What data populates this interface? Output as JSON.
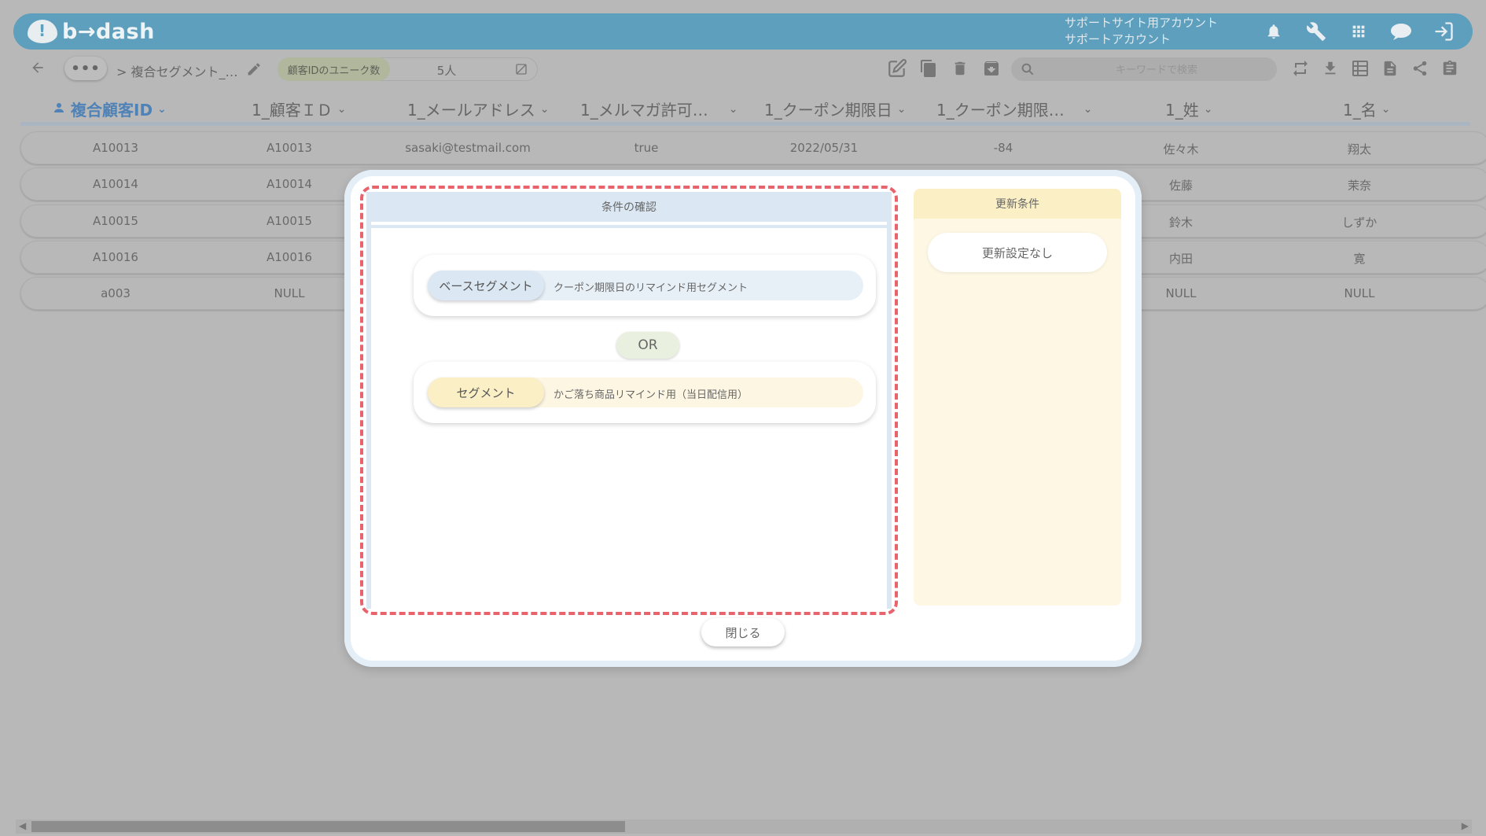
{
  "header": {
    "brand": "b→dash",
    "account_line1": "サポートサイト用アカウント",
    "account_line2": "サポートアカウント"
  },
  "toolbar": {
    "more_label": "•••",
    "breadcrumb": "> 複合セグメント_…",
    "unique_label": "顧客IDのユニーク数",
    "unique_value": "5人",
    "search_placeholder": "キーワードで検索"
  },
  "table": {
    "columns": [
      "複合顧客ID",
      "1_顧客ＩＤ",
      "1_メールアドレス",
      "1_メルマガ許可…",
      "1_クーポン期限日",
      "1_クーポン期限…",
      "1_姓",
      "1_名"
    ],
    "rows": [
      [
        "A10013",
        "A10013",
        "sasaki@testmail.com",
        "true",
        "2022/05/31",
        "-84",
        "佐々木",
        "翔太"
      ],
      [
        "A10014",
        "A10014",
        "",
        "",
        "",
        "",
        "佐藤",
        "茉奈"
      ],
      [
        "A10015",
        "A10015",
        "",
        "",
        "",
        "",
        "鈴木",
        "しずか"
      ],
      [
        "A10016",
        "A10016",
        "",
        "",
        "",
        "",
        "内田",
        "寛"
      ],
      [
        "a003",
        "NULL",
        "",
        "",
        "",
        "",
        "NULL",
        "NULL"
      ]
    ]
  },
  "modal": {
    "conditions_title": "条件の確認",
    "base_segment_label": "ベースセグメント",
    "base_segment_name": "クーポン期限日のリマインド用セグメント",
    "operator": "OR",
    "segment_label": "セグメント",
    "segment_name": "かご落ち商品リマインド用（当日配信用）",
    "update_title": "更新条件",
    "update_none": "更新設定なし",
    "close_label": "閉じる"
  },
  "colors": {
    "appbar": "#5d9fbd",
    "dashed_highlight": "#e8636c",
    "conditions_header": "#dbe8f3",
    "base_segment_pill": "#dbe8f3",
    "segment_pill": "#fbefc6",
    "update_panel": "#fdf7e4"
  },
  "icons": [
    "bell-icon",
    "wrench-icon",
    "apps-grid-icon",
    "chat-bubble-icon",
    "logout-icon",
    "back-arrow-icon",
    "pencil-icon",
    "visibility-off-icon",
    "edit-note-icon",
    "copy-icon",
    "trash-icon",
    "archive-icon",
    "search-icon",
    "sync-icon",
    "download-icon",
    "table-view-icon",
    "document-icon",
    "share-icon",
    "clipboard-icon",
    "person-icon"
  ]
}
